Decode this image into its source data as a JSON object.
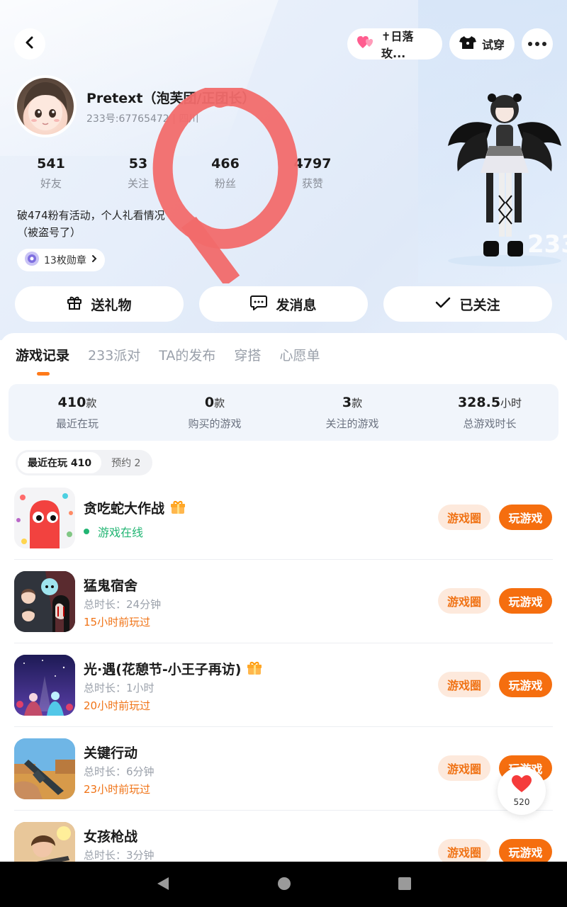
{
  "header": {
    "pill_title": "✝日落玫...",
    "tryon_label": "试穿"
  },
  "profile": {
    "name": "Pretext（泡芙团/正团长）",
    "id_line": "233号:67765472 | 四川",
    "stats": [
      {
        "num": "541",
        "label": "好友"
      },
      {
        "num": "53",
        "label": "关注"
      },
      {
        "num": "466",
        "label": "粉丝"
      },
      {
        "num": "4797",
        "label": "获赞"
      }
    ],
    "bio_line1": "破474粉有活动，个人礼看情况",
    "bio_line2": "（被盗号了）",
    "badge_label": "13枚勋章"
  },
  "actions": {
    "gift": "送礼物",
    "message": "发消息",
    "following": "已关注"
  },
  "tabs": [
    "游戏记录",
    "233派对",
    "TA的发布",
    "穿搭",
    "心愿单"
  ],
  "summary": [
    {
      "value": "410",
      "unit": "款",
      "label": "最近在玩"
    },
    {
      "value": "0",
      "unit": "款",
      "label": "购买的游戏"
    },
    {
      "value": "3",
      "unit": "款",
      "label": "关注的游戏"
    },
    {
      "value": "328.5",
      "unit": "小时",
      "label": "总游戏时长"
    }
  ],
  "filters": {
    "recent": "最近在玩 410",
    "reserve": "预约 2"
  },
  "buttons": {
    "circle": "游戏圈",
    "play": "玩游戏"
  },
  "games": [
    {
      "title": "贪吃蛇大作战",
      "status": "游戏在线",
      "duration": "",
      "recent": ""
    },
    {
      "title": "猛鬼宿舍",
      "status": "",
      "duration": "总时长：24分钟",
      "recent": "15小时前玩过"
    },
    {
      "title": "光·遇(花憩节-小王子再访)",
      "status": "",
      "duration": "总时长：1小时",
      "recent": "20小时前玩过"
    },
    {
      "title": "关键行动",
      "status": "",
      "duration": "总时长：6分钟",
      "recent": "23小时前玩过"
    },
    {
      "title": "女孩枪战",
      "status": "",
      "duration": "总时长：3分钟",
      "recent": ""
    }
  ],
  "like": {
    "count": "520"
  },
  "colors": {
    "accent": "#f56e0f",
    "online": "#22b573",
    "annotation": "#f26b6b"
  }
}
